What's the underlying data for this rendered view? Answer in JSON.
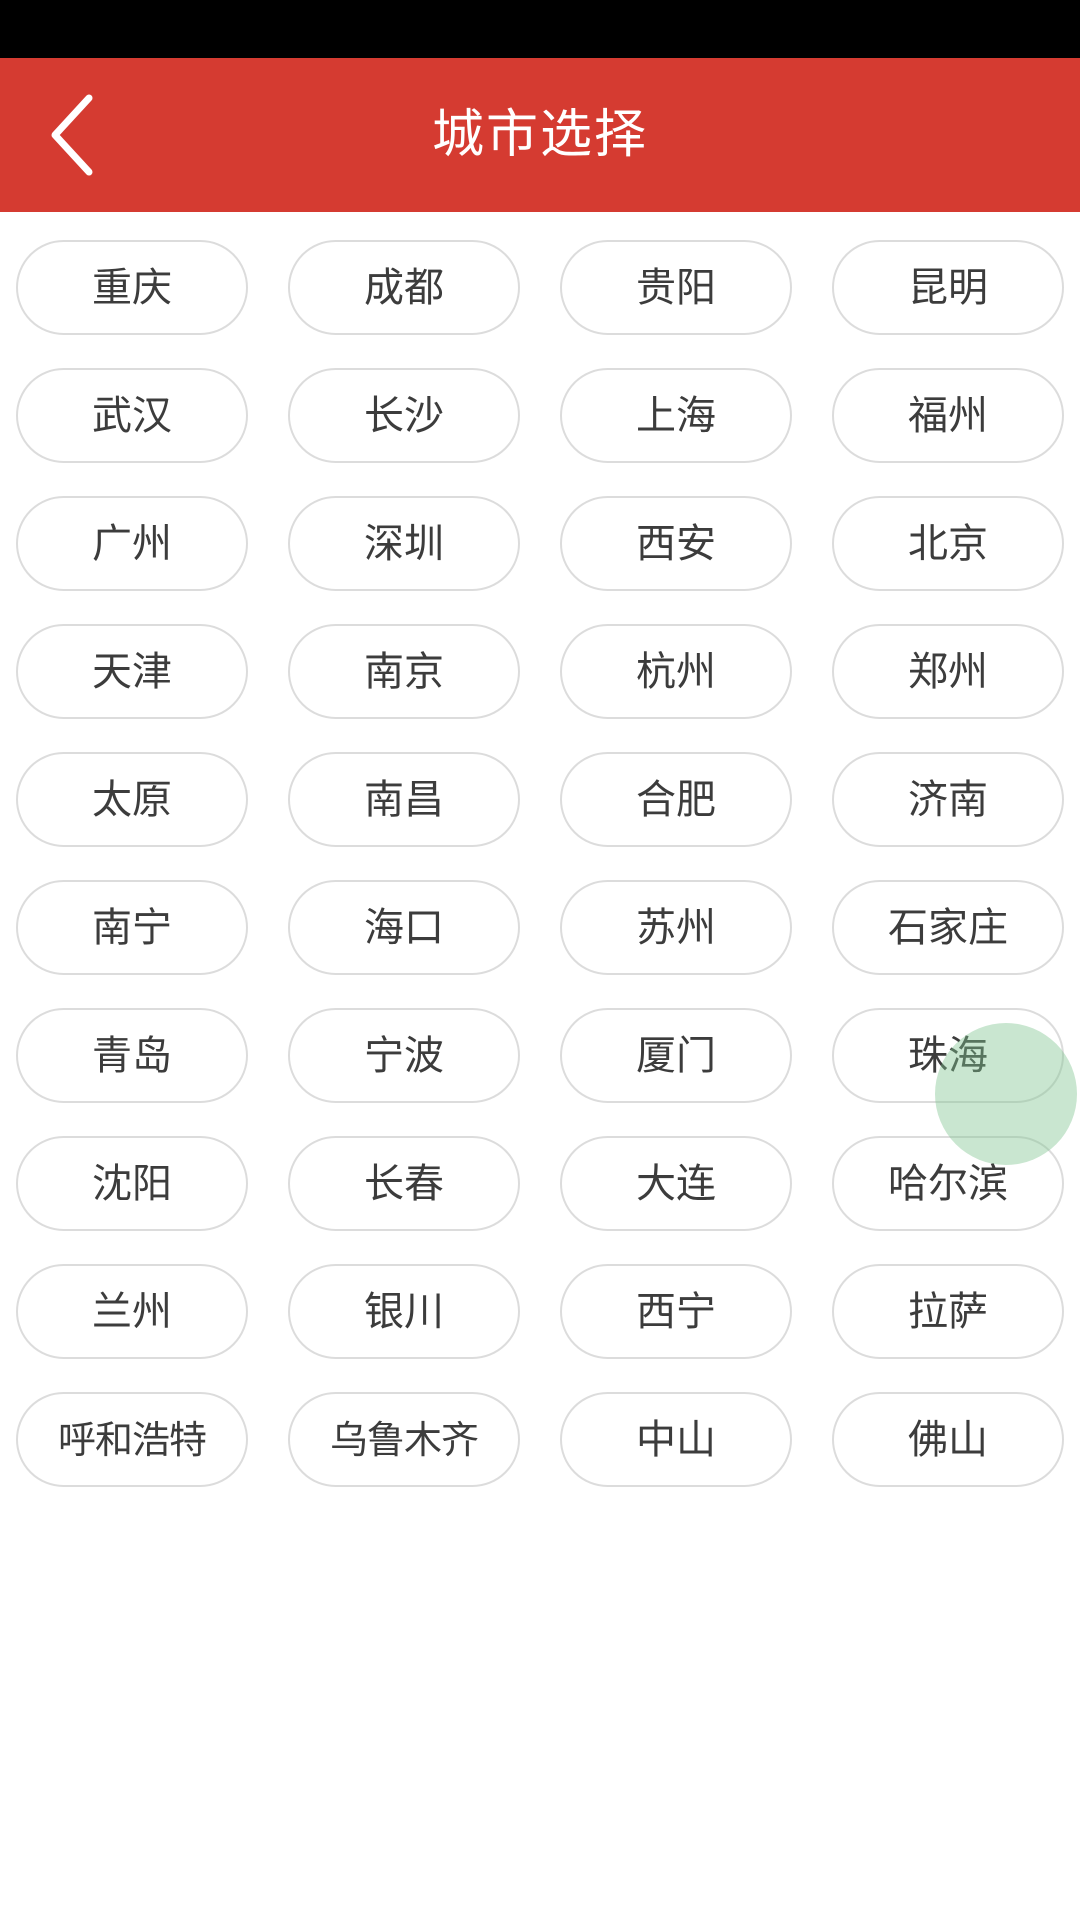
{
  "app_bar": {
    "title": "城市选择",
    "back_icon": "chevron-left-icon",
    "background_color": "#d53b31",
    "title_color": "#ffffff"
  },
  "status_bar": {
    "background_color": "#000000"
  },
  "city_grid": {
    "columns": 4,
    "chip_border_color": "#dcdcdc",
    "chip_text_color": "#3c3c3c",
    "cities": [
      "重庆",
      "成都",
      "贵阳",
      "昆明",
      "武汉",
      "长沙",
      "上海",
      "福州",
      "广州",
      "深圳",
      "西安",
      "北京",
      "天津",
      "南京",
      "杭州",
      "郑州",
      "太原",
      "南昌",
      "合肥",
      "济南",
      "南宁",
      "海口",
      "苏州",
      "石家庄",
      "青岛",
      "宁波",
      "厦门",
      "珠海",
      "沈阳",
      "长春",
      "大连",
      "哈尔滨",
      "兰州",
      "银川",
      "西宁",
      "拉萨",
      "呼和浩特",
      "乌鲁木齐",
      "中山",
      "佛山"
    ]
  },
  "touch_indicator": {
    "color": "#7ec490",
    "target_city": "石家庄"
  }
}
